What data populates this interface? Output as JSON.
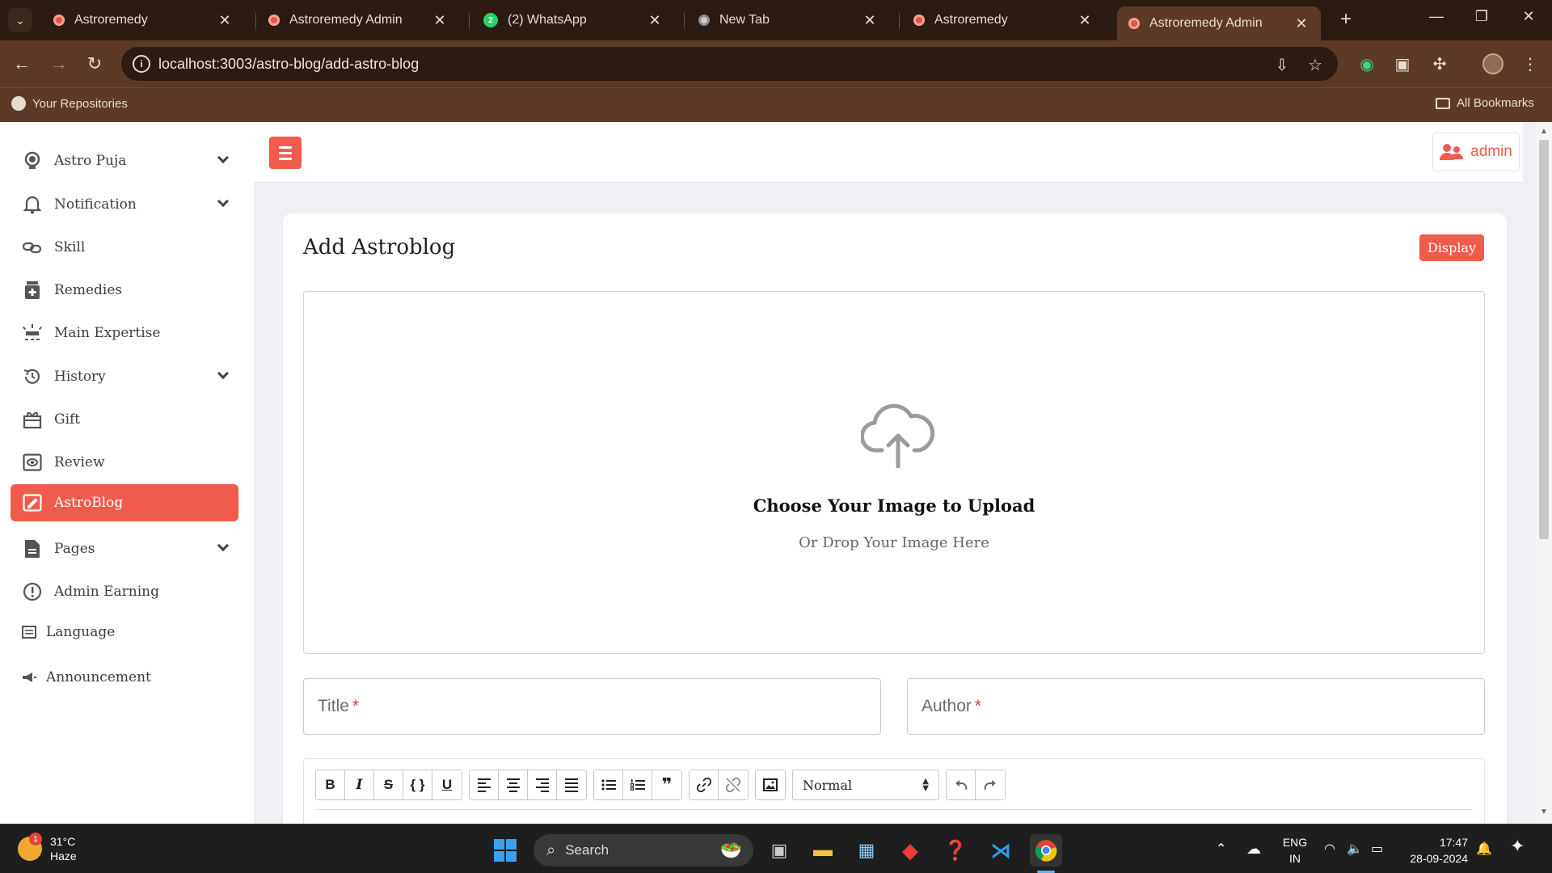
{
  "browser": {
    "tabs": [
      {
        "label": "Astroremedy",
        "icon": "astroremedy-favicon"
      },
      {
        "label": "Astroremedy Admin",
        "icon": "astroremedy-favicon"
      },
      {
        "label": "(2) WhatsApp",
        "icon": "whatsapp-favicon",
        "badge": "2"
      },
      {
        "label": "New Tab",
        "icon": "chrome-favicon"
      },
      {
        "label": "Astroremedy",
        "icon": "astroremedy-favicon"
      },
      {
        "label": "Astroremedy Admin",
        "icon": "astroremedy-favicon",
        "active": true
      }
    ],
    "url": "localhost:3003/astro-blog/add-astro-blog",
    "bookmarks": {
      "left": "Your Repositories",
      "right": "All Bookmarks"
    }
  },
  "sidebar": {
    "items": [
      {
        "label": "Astro Puja",
        "icon": "bulb-icon",
        "dropdown": true
      },
      {
        "label": "Notification",
        "icon": "bell-icon",
        "dropdown": true
      },
      {
        "label": "Skill",
        "icon": "link-icon",
        "dropdown": false
      },
      {
        "label": "Remedies",
        "icon": "medicine-icon",
        "dropdown": false
      },
      {
        "label": "Main Expertise",
        "icon": "expertise-icon",
        "dropdown": false
      },
      {
        "label": "History",
        "icon": "history-icon",
        "dropdown": true
      },
      {
        "label": "Gift",
        "icon": "gift-icon",
        "dropdown": false
      },
      {
        "label": "Review",
        "icon": "review-icon",
        "dropdown": false
      },
      {
        "label": "AstroBlog",
        "icon": "blog-icon",
        "dropdown": false,
        "active": true
      },
      {
        "label": "Pages",
        "icon": "page-icon",
        "dropdown": true
      },
      {
        "label": "Admin Earning",
        "icon": "earning-icon",
        "dropdown": false
      },
      {
        "label": "Language",
        "icon": "language-icon",
        "dropdown": false
      },
      {
        "label": "Announcement",
        "icon": "megaphone-icon",
        "dropdown": false
      }
    ]
  },
  "header": {
    "user_label": "admin"
  },
  "main": {
    "title": "Add Astroblog",
    "display_button": "Display",
    "upload": {
      "title": "Choose Your Image to Upload",
      "subtitle": "Or Drop Your Image Here"
    },
    "fields": {
      "title_label": "Title",
      "author_label": "Author",
      "required_mark": "*"
    },
    "editor": {
      "format_select": "Normal",
      "buttons": [
        "bold",
        "italic",
        "strike",
        "code-block",
        "underline",
        "align-left",
        "align-center",
        "align-right",
        "align-justify",
        "bullet-list",
        "ordered-list",
        "blockquote",
        "link",
        "unlink",
        "image",
        "undo",
        "redo"
      ],
      "labels": {
        "bold": "B",
        "italic": "I",
        "strike": "S",
        "code": "{ }",
        "underline": "U",
        "quote": "❞"
      }
    }
  },
  "taskbar": {
    "weather": {
      "temp": "31°C",
      "condition": "Haze",
      "badge": "1"
    },
    "search_label": "Search",
    "lang_top": "ENG",
    "lang_bottom": "IN",
    "time": "17:47",
    "date": "28-09-2024"
  },
  "colors": {
    "accent": "#ef5b4c",
    "chrome_dark": "#2b1b12",
    "chrome": "#5b3b27",
    "page_bg": "#eef0f4"
  }
}
